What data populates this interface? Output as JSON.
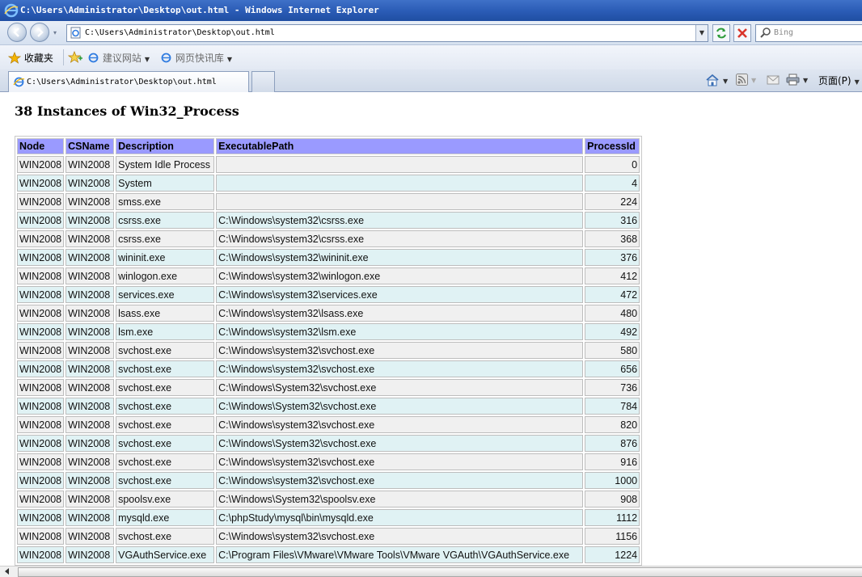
{
  "window": {
    "title": "C:\\Users\\Administrator\\Desktop\\out.html - Windows Internet Explorer"
  },
  "address_bar": {
    "url": "C:\\Users\\Administrator\\Desktop\\out.html",
    "search_placeholder": "Bing"
  },
  "favorites_bar": {
    "favorites_label": "收藏夹",
    "suggested_sites_label": "建议网站",
    "web_slice_gallery_label": "网页快讯库"
  },
  "tabs": [
    {
      "label": "C:\\Users\\Administrator\\Desktop\\out.html"
    }
  ],
  "command_bar": {
    "page_label": "页面(P)"
  },
  "page": {
    "title": "38 Instances of Win32_Process",
    "columns": [
      "Node",
      "CSName",
      "Description",
      "ExecutablePath",
      "ProcessId"
    ],
    "rows": [
      [
        "WIN2008",
        "WIN2008",
        "System Idle Process",
        "",
        "0"
      ],
      [
        "WIN2008",
        "WIN2008",
        "System",
        "",
        "4"
      ],
      [
        "WIN2008",
        "WIN2008",
        "smss.exe",
        "",
        "224"
      ],
      [
        "WIN2008",
        "WIN2008",
        "csrss.exe",
        "C:\\Windows\\system32\\csrss.exe",
        "316"
      ],
      [
        "WIN2008",
        "WIN2008",
        "csrss.exe",
        "C:\\Windows\\system32\\csrss.exe",
        "368"
      ],
      [
        "WIN2008",
        "WIN2008",
        "wininit.exe",
        "C:\\Windows\\system32\\wininit.exe",
        "376"
      ],
      [
        "WIN2008",
        "WIN2008",
        "winlogon.exe",
        "C:\\Windows\\system32\\winlogon.exe",
        "412"
      ],
      [
        "WIN2008",
        "WIN2008",
        "services.exe",
        "C:\\Windows\\system32\\services.exe",
        "472"
      ],
      [
        "WIN2008",
        "WIN2008",
        "lsass.exe",
        "C:\\Windows\\system32\\lsass.exe",
        "480"
      ],
      [
        "WIN2008",
        "WIN2008",
        "lsm.exe",
        "C:\\Windows\\system32\\lsm.exe",
        "492"
      ],
      [
        "WIN2008",
        "WIN2008",
        "svchost.exe",
        "C:\\Windows\\system32\\svchost.exe",
        "580"
      ],
      [
        "WIN2008",
        "WIN2008",
        "svchost.exe",
        "C:\\Windows\\system32\\svchost.exe",
        "656"
      ],
      [
        "WIN2008",
        "WIN2008",
        "svchost.exe",
        "C:\\Windows\\System32\\svchost.exe",
        "736"
      ],
      [
        "WIN2008",
        "WIN2008",
        "svchost.exe",
        "C:\\Windows\\System32\\svchost.exe",
        "784"
      ],
      [
        "WIN2008",
        "WIN2008",
        "svchost.exe",
        "C:\\Windows\\system32\\svchost.exe",
        "820"
      ],
      [
        "WIN2008",
        "WIN2008",
        "svchost.exe",
        "C:\\Windows\\System32\\svchost.exe",
        "876"
      ],
      [
        "WIN2008",
        "WIN2008",
        "svchost.exe",
        "C:\\Windows\\system32\\svchost.exe",
        "916"
      ],
      [
        "WIN2008",
        "WIN2008",
        "svchost.exe",
        "C:\\Windows\\system32\\svchost.exe",
        "1000"
      ],
      [
        "WIN2008",
        "WIN2008",
        "spoolsv.exe",
        "C:\\Windows\\System32\\spoolsv.exe",
        "908"
      ],
      [
        "WIN2008",
        "WIN2008",
        "mysqld.exe",
        "C:\\phpStudy\\mysql\\bin\\mysqld.exe",
        "1112"
      ],
      [
        "WIN2008",
        "WIN2008",
        "svchost.exe",
        "C:\\Windows\\system32\\svchost.exe",
        "1156"
      ],
      [
        "WIN2008",
        "WIN2008",
        "VGAuthService.exe",
        "C:\\Program Files\\VMware\\VMware Tools\\VMware VGAuth\\VGAuthService.exe",
        "1224"
      ]
    ]
  },
  "colors": {
    "header_bg": "#9a9aff",
    "row_odd_bg": "#f0f0f0",
    "row_even_bg": "#e0f2f4",
    "titlebar_bg": "#2a5bb5"
  }
}
